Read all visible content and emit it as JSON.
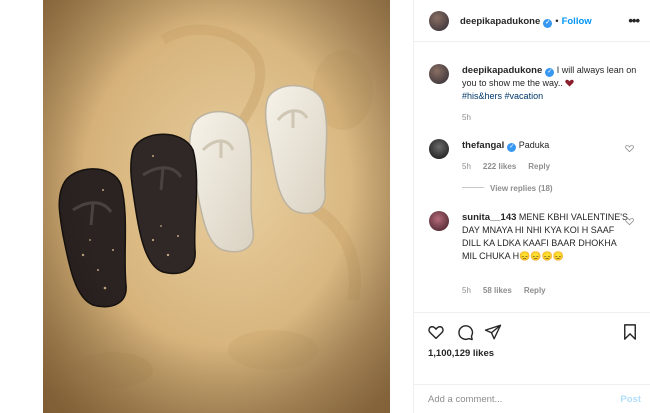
{
  "post": {
    "username": "deepikapadukone",
    "follow_label": "Follow",
    "more_icon": "•••",
    "caption_text": "I will always lean on you to show me the way..",
    "hashtags": [
      "#his&hers",
      "#vacation"
    ],
    "caption_time": "5h",
    "likes": "1,100,129 likes"
  },
  "comments": [
    {
      "username": "thefangal",
      "verified": true,
      "text": "Paduka",
      "time": "5h",
      "likes": "222 likes",
      "reply": "Reply",
      "view_replies": "View replies (18)"
    },
    {
      "username": "sunita__143",
      "verified": false,
      "text": "MENE KBHI VALENTINE'S DAY MNAYA HI NHI KYA KOI H SAAF DILL KA LDKA KAAFI BAAR DHOKHA MIL CHUKA H😞😞😞😞",
      "time": "5h",
      "likes": "58 likes",
      "reply": "Reply"
    }
  ],
  "add_comment": {
    "placeholder": "Add a comment...",
    "post_label": "Post"
  },
  "colors": {
    "accent": "#0095f6",
    "verified": "#3897f0",
    "hashtag": "#00376b"
  }
}
